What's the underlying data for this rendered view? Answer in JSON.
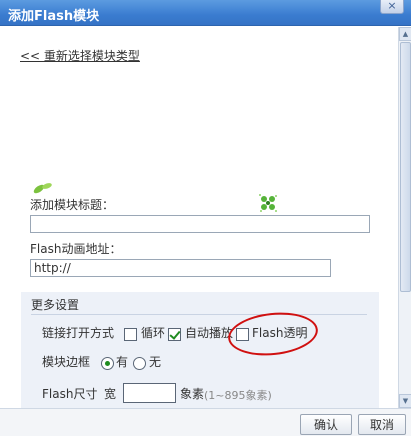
{
  "dialog": {
    "title": "添加Flash模块",
    "close_symbol": "×"
  },
  "back_link": "<< 重新选择模块类型",
  "module_title": {
    "label": "添加模块标题：",
    "value": ""
  },
  "flash_url": {
    "label": "Flash动画地址：",
    "value": "http://"
  },
  "more_settings": {
    "title": "更多设置",
    "link_open_label": "链接打开方式",
    "loop": {
      "label": "循环",
      "checked": false
    },
    "autoplay": {
      "label": "自动播放",
      "checked": true
    },
    "transparent": {
      "label": "Flash透明",
      "checked": false
    },
    "border_label": "模块边框",
    "border_yes": {
      "label": "有",
      "checked": true
    },
    "border_no": {
      "label": "无",
      "checked": false
    },
    "size_label": "Flash尺寸",
    "width_label": "宽",
    "width_value": "",
    "unit_label": "象素",
    "range_hint": "(1~895象素)"
  },
  "footer": {
    "confirm": "确认",
    "cancel": "取消"
  },
  "colors": {
    "titlebar": "#3a7cd0",
    "panel_bg": "#edf1f8",
    "annotation_circle": "#d01010",
    "check_green": "#1f8c1f"
  }
}
